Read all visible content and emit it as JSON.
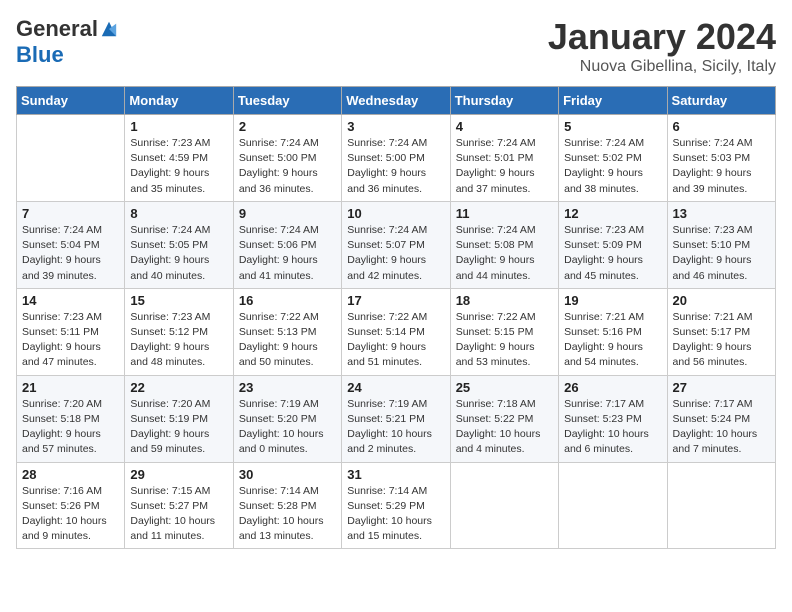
{
  "logo": {
    "general": "General",
    "blue": "Blue"
  },
  "title": "January 2024",
  "location": "Nuova Gibellina, Sicily, Italy",
  "days_of_week": [
    "Sunday",
    "Monday",
    "Tuesday",
    "Wednesday",
    "Thursday",
    "Friday",
    "Saturday"
  ],
  "weeks": [
    [
      {
        "day": "",
        "info": ""
      },
      {
        "day": "1",
        "info": "Sunrise: 7:23 AM\nSunset: 4:59 PM\nDaylight: 9 hours\nand 35 minutes."
      },
      {
        "day": "2",
        "info": "Sunrise: 7:24 AM\nSunset: 5:00 PM\nDaylight: 9 hours\nand 36 minutes."
      },
      {
        "day": "3",
        "info": "Sunrise: 7:24 AM\nSunset: 5:00 PM\nDaylight: 9 hours\nand 36 minutes."
      },
      {
        "day": "4",
        "info": "Sunrise: 7:24 AM\nSunset: 5:01 PM\nDaylight: 9 hours\nand 37 minutes."
      },
      {
        "day": "5",
        "info": "Sunrise: 7:24 AM\nSunset: 5:02 PM\nDaylight: 9 hours\nand 38 minutes."
      },
      {
        "day": "6",
        "info": "Sunrise: 7:24 AM\nSunset: 5:03 PM\nDaylight: 9 hours\nand 39 minutes."
      }
    ],
    [
      {
        "day": "7",
        "info": "Sunrise: 7:24 AM\nSunset: 5:04 PM\nDaylight: 9 hours\nand 39 minutes."
      },
      {
        "day": "8",
        "info": "Sunrise: 7:24 AM\nSunset: 5:05 PM\nDaylight: 9 hours\nand 40 minutes."
      },
      {
        "day": "9",
        "info": "Sunrise: 7:24 AM\nSunset: 5:06 PM\nDaylight: 9 hours\nand 41 minutes."
      },
      {
        "day": "10",
        "info": "Sunrise: 7:24 AM\nSunset: 5:07 PM\nDaylight: 9 hours\nand 42 minutes."
      },
      {
        "day": "11",
        "info": "Sunrise: 7:24 AM\nSunset: 5:08 PM\nDaylight: 9 hours\nand 44 minutes."
      },
      {
        "day": "12",
        "info": "Sunrise: 7:23 AM\nSunset: 5:09 PM\nDaylight: 9 hours\nand 45 minutes."
      },
      {
        "day": "13",
        "info": "Sunrise: 7:23 AM\nSunset: 5:10 PM\nDaylight: 9 hours\nand 46 minutes."
      }
    ],
    [
      {
        "day": "14",
        "info": "Sunrise: 7:23 AM\nSunset: 5:11 PM\nDaylight: 9 hours\nand 47 minutes."
      },
      {
        "day": "15",
        "info": "Sunrise: 7:23 AM\nSunset: 5:12 PM\nDaylight: 9 hours\nand 48 minutes."
      },
      {
        "day": "16",
        "info": "Sunrise: 7:22 AM\nSunset: 5:13 PM\nDaylight: 9 hours\nand 50 minutes."
      },
      {
        "day": "17",
        "info": "Sunrise: 7:22 AM\nSunset: 5:14 PM\nDaylight: 9 hours\nand 51 minutes."
      },
      {
        "day": "18",
        "info": "Sunrise: 7:22 AM\nSunset: 5:15 PM\nDaylight: 9 hours\nand 53 minutes."
      },
      {
        "day": "19",
        "info": "Sunrise: 7:21 AM\nSunset: 5:16 PM\nDaylight: 9 hours\nand 54 minutes."
      },
      {
        "day": "20",
        "info": "Sunrise: 7:21 AM\nSunset: 5:17 PM\nDaylight: 9 hours\nand 56 minutes."
      }
    ],
    [
      {
        "day": "21",
        "info": "Sunrise: 7:20 AM\nSunset: 5:18 PM\nDaylight: 9 hours\nand 57 minutes."
      },
      {
        "day": "22",
        "info": "Sunrise: 7:20 AM\nSunset: 5:19 PM\nDaylight: 9 hours\nand 59 minutes."
      },
      {
        "day": "23",
        "info": "Sunrise: 7:19 AM\nSunset: 5:20 PM\nDaylight: 10 hours\nand 0 minutes."
      },
      {
        "day": "24",
        "info": "Sunrise: 7:19 AM\nSunset: 5:21 PM\nDaylight: 10 hours\nand 2 minutes."
      },
      {
        "day": "25",
        "info": "Sunrise: 7:18 AM\nSunset: 5:22 PM\nDaylight: 10 hours\nand 4 minutes."
      },
      {
        "day": "26",
        "info": "Sunrise: 7:17 AM\nSunset: 5:23 PM\nDaylight: 10 hours\nand 6 minutes."
      },
      {
        "day": "27",
        "info": "Sunrise: 7:17 AM\nSunset: 5:24 PM\nDaylight: 10 hours\nand 7 minutes."
      }
    ],
    [
      {
        "day": "28",
        "info": "Sunrise: 7:16 AM\nSunset: 5:26 PM\nDaylight: 10 hours\nand 9 minutes."
      },
      {
        "day": "29",
        "info": "Sunrise: 7:15 AM\nSunset: 5:27 PM\nDaylight: 10 hours\nand 11 minutes."
      },
      {
        "day": "30",
        "info": "Sunrise: 7:14 AM\nSunset: 5:28 PM\nDaylight: 10 hours\nand 13 minutes."
      },
      {
        "day": "31",
        "info": "Sunrise: 7:14 AM\nSunset: 5:29 PM\nDaylight: 10 hours\nand 15 minutes."
      },
      {
        "day": "",
        "info": ""
      },
      {
        "day": "",
        "info": ""
      },
      {
        "day": "",
        "info": ""
      }
    ]
  ]
}
